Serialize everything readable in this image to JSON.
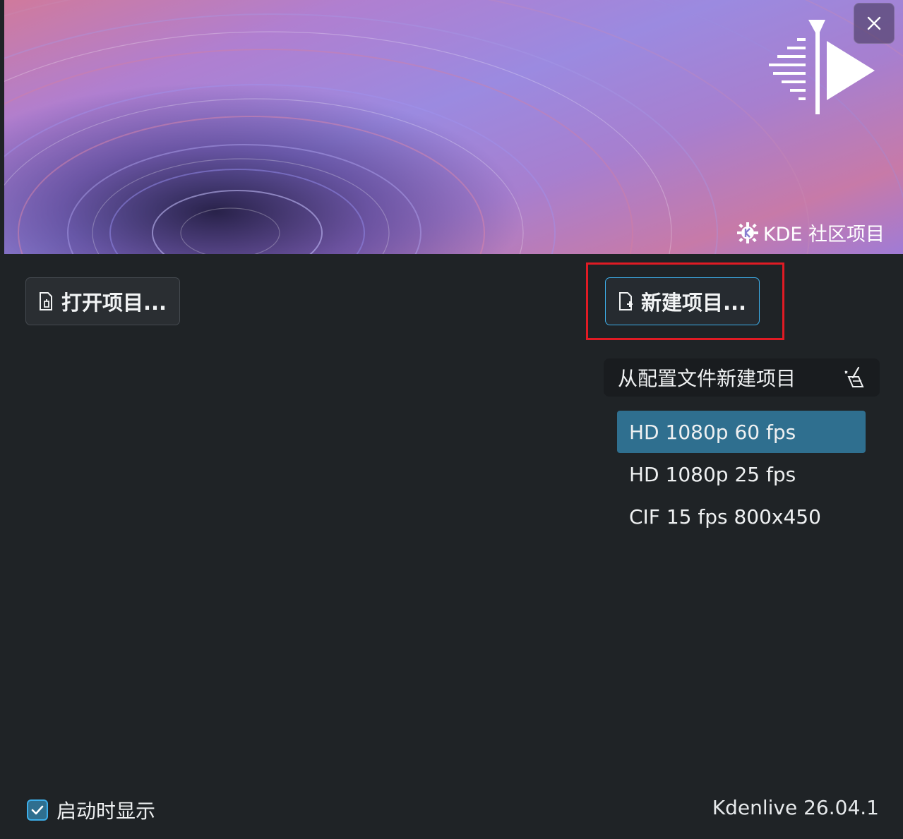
{
  "banner": {
    "community_label": "KDE 社区项目",
    "logo_icon": "kdenlive-logo-icon",
    "close_icon": "close-icon"
  },
  "actions": {
    "open_project_label": "打开项目...",
    "new_project_label": "新建项目..."
  },
  "profiles": {
    "header_label": "从配置文件新建项目",
    "header_icon": "clear-brush-icon",
    "items": [
      {
        "label": "HD 1080p 60 fps",
        "selected": true
      },
      {
        "label": "HD 1080p 25 fps",
        "selected": false
      },
      {
        "label": "CIF 15 fps 800x450",
        "selected": false
      }
    ]
  },
  "footer": {
    "show_on_startup_label": "启动时显示",
    "show_on_startup_checked": true,
    "version": "Kdenlive 26.04.1"
  },
  "colors": {
    "accent": "#3daee9",
    "selection": "#2f6f8f",
    "background": "#1f2326",
    "highlight_box": "#e01b24"
  }
}
